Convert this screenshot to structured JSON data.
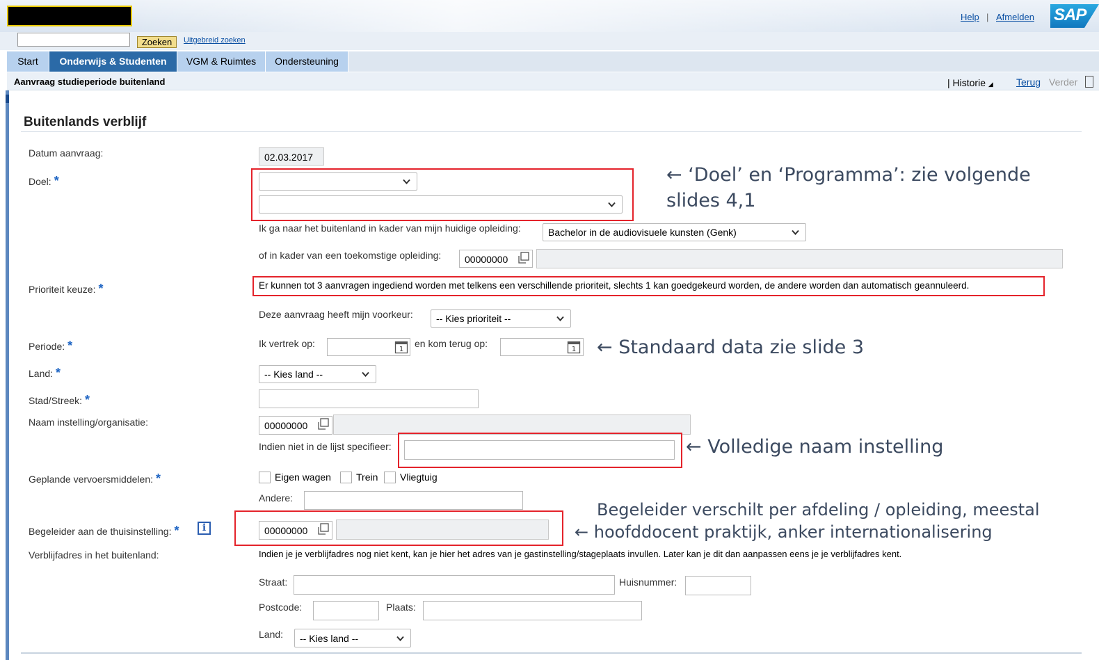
{
  "header": {
    "help": "Help",
    "separator": "|",
    "logout": "Afmelden",
    "sap_logo": "SAP"
  },
  "search": {
    "value": "",
    "button": "Zoeken",
    "advanced": "Uitgebreid zoeken"
  },
  "tabs": [
    {
      "label": "Start",
      "active": false
    },
    {
      "label": "Onderwijs & Studenten",
      "active": true
    },
    {
      "label": "VGM & Ruimtes",
      "active": false
    },
    {
      "label": "Ondersteuning",
      "active": false
    }
  ],
  "titlebar": {
    "title": "Aanvraag studieperiode buitenland",
    "historie": "| Historie",
    "back": "Terug",
    "forward": "Verder"
  },
  "section": {
    "title": "Buitenlands verblijf"
  },
  "form": {
    "datum_label": "Datum aanvraag:",
    "datum_value": "02.03.2017",
    "doel_label": "Doel:",
    "doel_value": "",
    "programma_value": "",
    "opleiding_label": "Ik ga naar het buitenland in kader van mijn huidige opleiding:",
    "opleiding_value": "Bachelor in de audiovisuele kunsten (Genk)",
    "toekomst_label": "of in kader van een toekomstige opleiding:",
    "toekomst_value": "00000000",
    "prioriteit_label": "Prioriteit keuze:",
    "prioriteit_info": "Er kunnen tot 3 aanvragen ingediend worden met telkens een verschillende prioriteit, slechts 1 kan goedgekeurd worden, de andere worden dan automatisch geannuleerd.",
    "voorkeur_label": "Deze aanvraag heeft mijn voorkeur:",
    "voorkeur_value": "-- Kies prioriteit --",
    "periode_label": "Periode:",
    "vertrek_label": "Ik vertrek op:",
    "vertrek_value": "",
    "terug_label": "en kom terug op:",
    "terug_value": "",
    "land_label": "Land:",
    "land_value": "-- Kies land --",
    "stad_label": "Stad/Streek:",
    "stad_value": "",
    "instelling_label": "Naam instelling/organisatie:",
    "instelling_value": "00000000",
    "specificeer_label": "Indien niet in de lijst specifieer:",
    "specificeer_value": "",
    "vervoer_label": "Geplande vervoersmiddelen:",
    "vervoer_options": [
      "Eigen wagen",
      "Trein",
      "Vliegtuig"
    ],
    "andere_label": "Andere:",
    "andere_value": "",
    "begeleider_label": "Begeleider aan de thuisinstelling:",
    "begeleider_value": "00000000",
    "info_icon": "i",
    "verblijf_label": "Verblijfadres in het buitenland:",
    "verblijf_info": "Indien je je verblijfadres nog niet kent, kan je hier het adres van je gastinstelling/stageplaats invullen. Later kan je dit dan aanpassen eens je je verblijfadres kent.",
    "straat_label": "Straat:",
    "huisnummer_label": "Huisnummer:",
    "postcode_label": "Postcode:",
    "plaats_label": "Plaats:",
    "adres_land_label": "Land:",
    "adres_land_value": "-- Kies land --",
    "required_marker": "*"
  },
  "annotations": {
    "doel_line1": "← ‘Doel’ en ‘Programma’: zie volgende",
    "doel_line2": "slides 4,1",
    "periode": "← Standaard data zie slide 3",
    "instelling": "← Volledige naam instelling",
    "begeleider_line1": "Begeleider verschilt per afdeling / opleiding, meestal",
    "begeleider_line2": "← hoofddocent praktijk, anker internationalisering"
  },
  "colors": {
    "accent_tab": "#2b6aa7",
    "tab": "#b7d1ee",
    "annotation_box": "#e4232b",
    "required": "#2066c4",
    "link": "#0a4fa3"
  }
}
